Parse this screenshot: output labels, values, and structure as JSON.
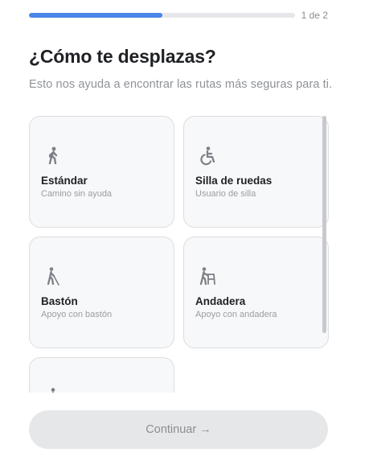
{
  "progress": {
    "fraction": 0.5,
    "label": "1 de 2",
    "color": "#4a86e8"
  },
  "header": {
    "title": "¿Cómo te desplazas?",
    "subtitle": "Esto nos ayuda a encontrar las rutas más seguras para ti."
  },
  "options": [
    {
      "icon": "walking-person-icon",
      "title": "Estándar",
      "description": "Camino sin ayuda"
    },
    {
      "icon": "wheelchair-icon",
      "title": "Silla de ruedas",
      "description": "Usuario de silla"
    },
    {
      "icon": "cane-person-icon",
      "title": "Bastón",
      "description": "Apoyo con bastón"
    },
    {
      "icon": "walker-person-icon",
      "title": "Andadera",
      "description": "Apoyo con andadera"
    },
    {
      "icon": "person-icon",
      "title": "",
      "description": ""
    }
  ],
  "footer": {
    "continue_label": "Continuar →"
  },
  "colors": {
    "icon": "#7d8086",
    "card_bg": "#f7f8fa",
    "card_border": "#dcdde1"
  }
}
